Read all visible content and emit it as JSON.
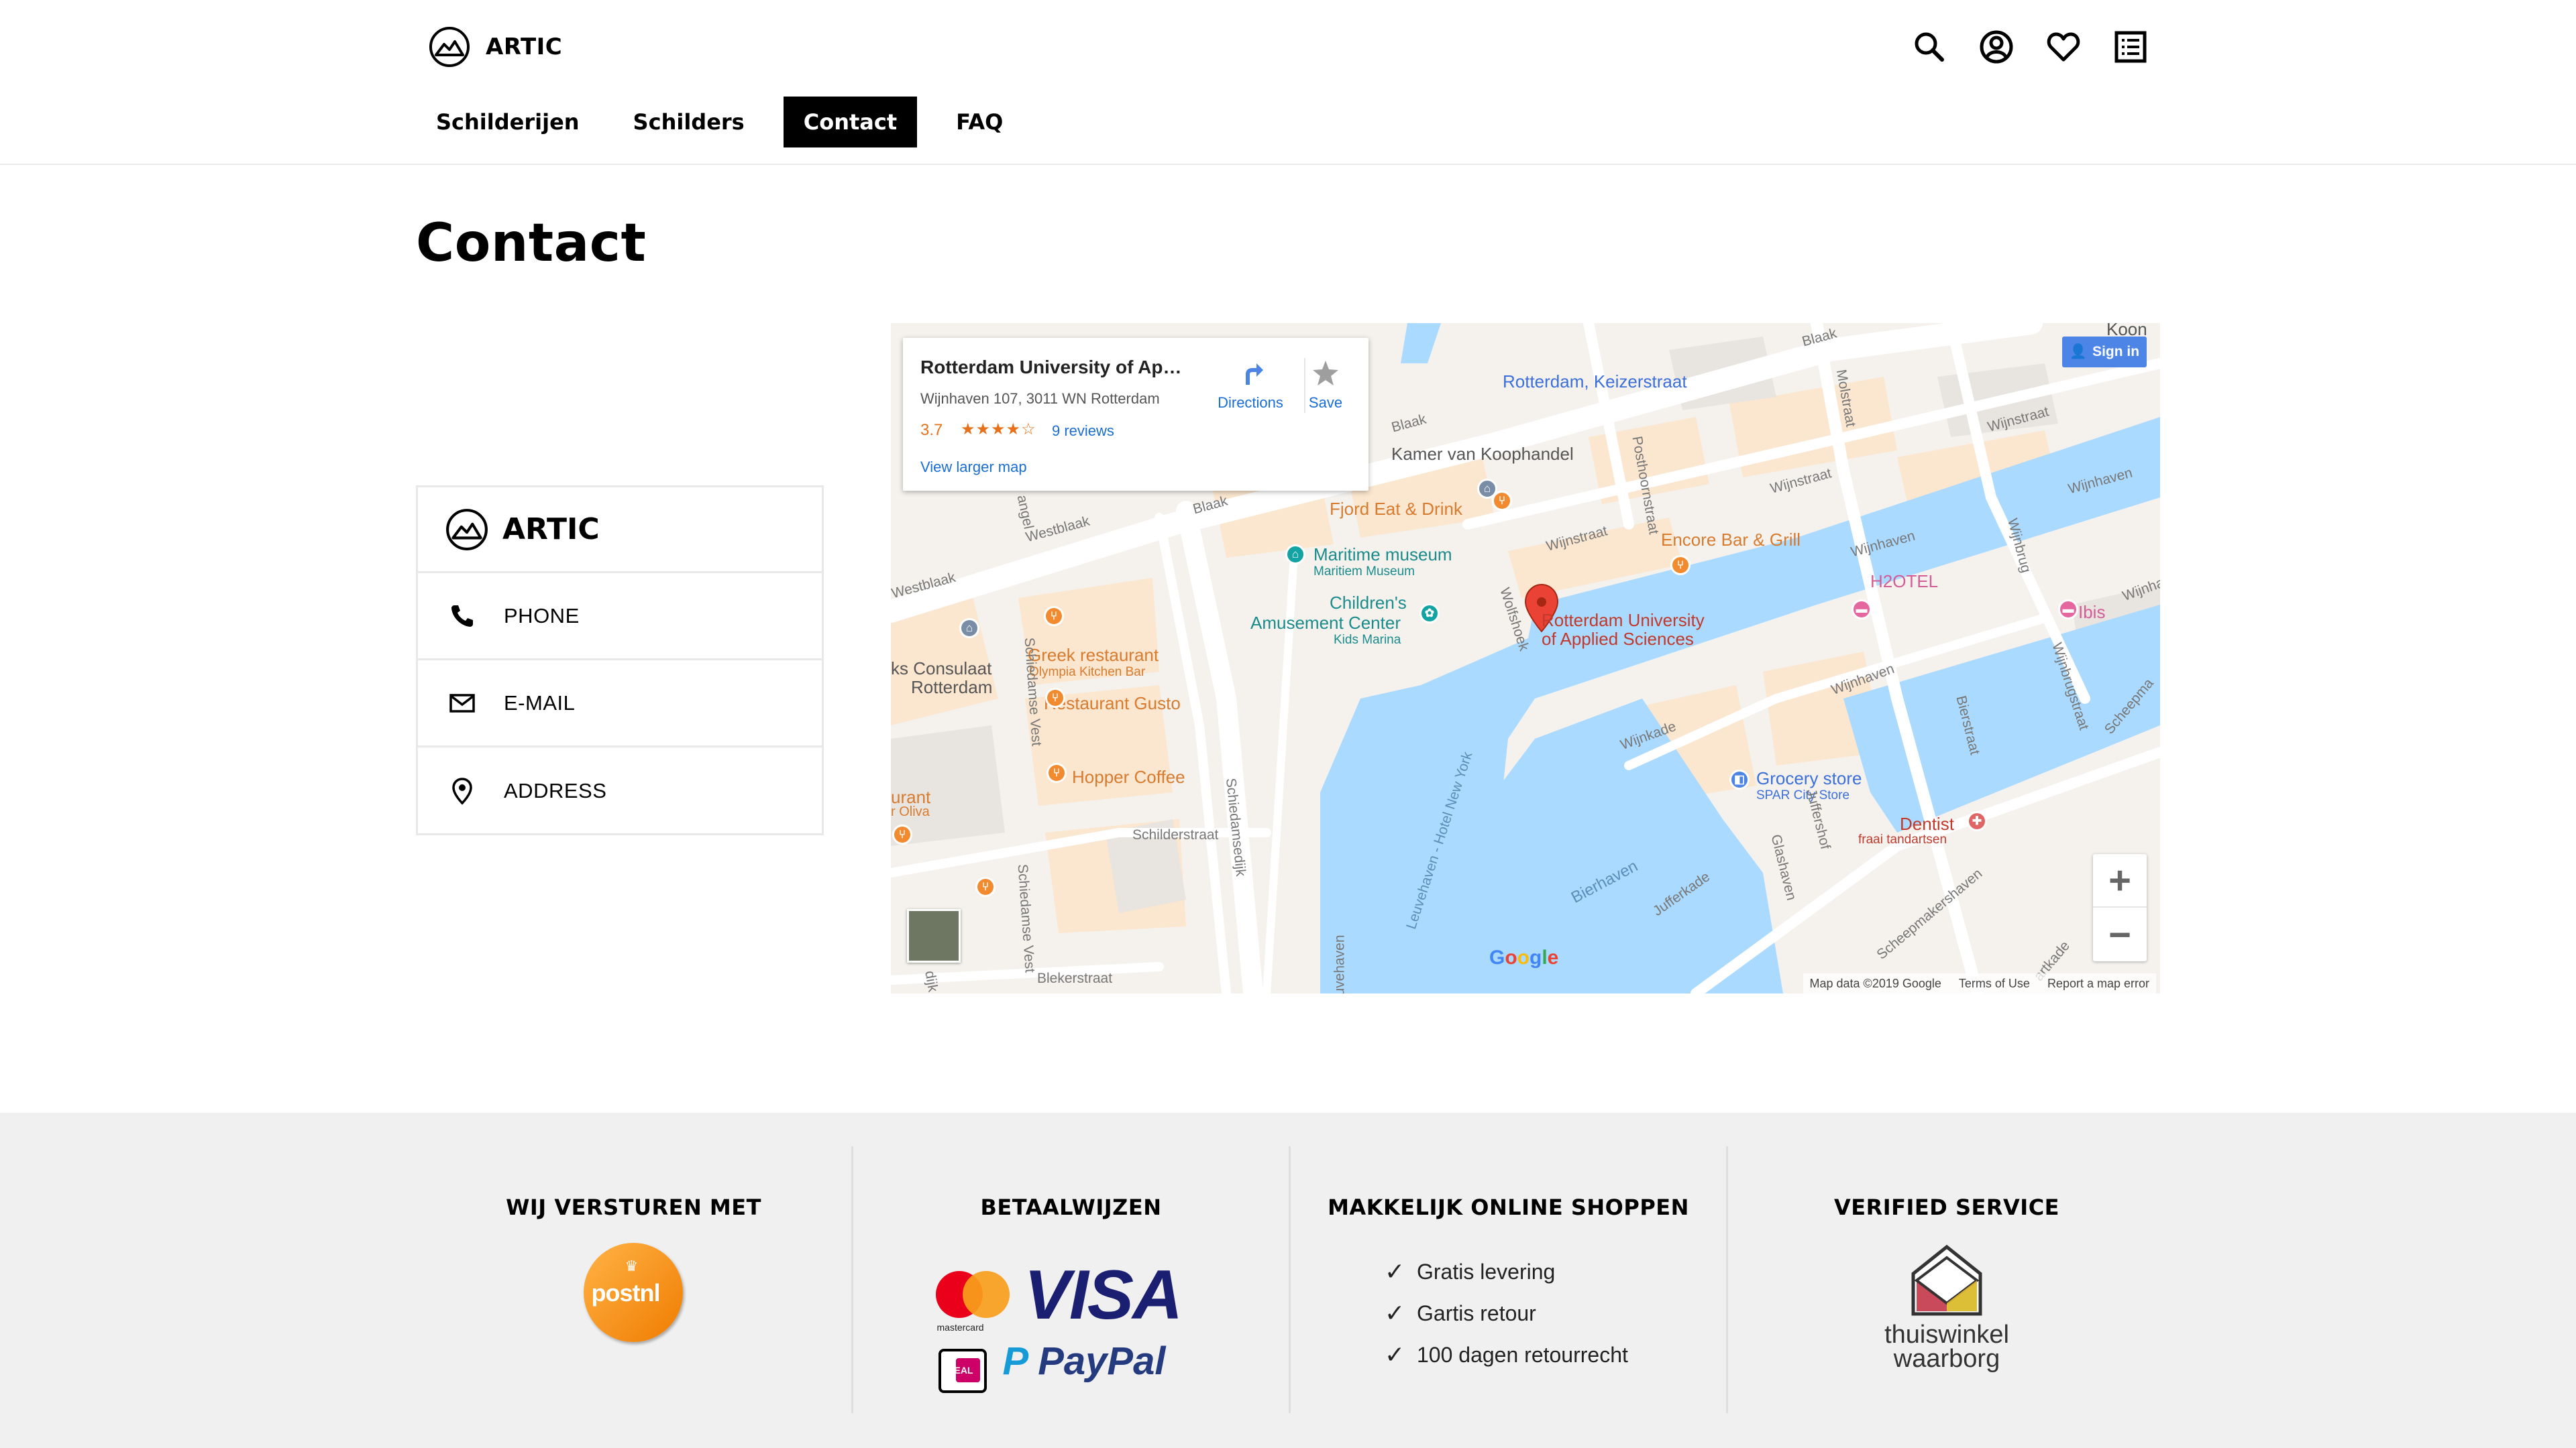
{
  "header": {
    "brand": "ARTIC",
    "nav": [
      {
        "label": "Schilderijen",
        "active": false
      },
      {
        "label": "Schilders",
        "active": false
      },
      {
        "label": "Contact",
        "active": true
      },
      {
        "label": "FAQ",
        "active": false
      }
    ],
    "icons": [
      "search-icon",
      "account-icon",
      "heart-icon",
      "list-icon"
    ]
  },
  "page": {
    "title": "Contact"
  },
  "contact_card": {
    "brand": "ARTIC",
    "rows": [
      {
        "icon": "phone-icon",
        "label": "PHONE"
      },
      {
        "icon": "mail-icon",
        "label": "E-MAIL"
      },
      {
        "icon": "location-pin-icon",
        "label": "ADDRESS"
      }
    ]
  },
  "map": {
    "info": {
      "title": "Rotterdam University of Applied Sciences",
      "title_display": "Rotterdam University of Appli...",
      "address": "Wijnhaven 107, 3011 WN Rotterdam",
      "rating": "3.7",
      "stars": "★★★★☆",
      "reviews": "9 reviews",
      "view_larger": "View larger map",
      "directions": "Directions",
      "save": "Save"
    },
    "sign_in": "Sign in",
    "zoom_in": "+",
    "zoom_out": "−",
    "google": "Google",
    "footer": [
      "Map data ©2019 Google",
      "Terms of Use",
      "Report a map error"
    ],
    "labels": {
      "keizerstraat": "Rotterdam, Keizerstraat",
      "kamer": "Kamer van Koophandel",
      "fjord": "Fjord Eat & Drink",
      "maritime": "Maritime museum",
      "maritime_sub": "Maritiem Museum",
      "childrens_1": "Children's",
      "childrens_2": "Amusement Center",
      "childrens_sub": "Kids Marina",
      "rotterdam_univ_1": "Rotterdam University",
      "rotterdam_univ_2": "of Applied Sciences",
      "encore": "Encore Bar & Grill",
      "h2otel": "H2OTEL",
      "ibis": "Ibis",
      "greek": "Greek restaurant",
      "greek_sub": "Olympia Kitchen Bar",
      "gusto": "Restaurant Gusto",
      "hopper": "Hopper Coffee",
      "consulaat_1": "ks Consulaat",
      "consulaat_2": "Rotterdam",
      "rant": "urant",
      "oliva": "r Oliva",
      "grocery": "Grocery store",
      "grocery_sub": "SPAR City Store",
      "dentist": "Dentist",
      "dentist_sub": "fraai tandartsen",
      "koon": "Koon",
      "streets": {
        "westblaak1": "Westblaak",
        "westblaak2": "Westblaak",
        "blaak1": "Blaak",
        "blaak2": "Blaak",
        "blaak3": "Blaak",
        "wijnstraat1": "Wijnstraat",
        "wijnstraat2": "Wijnstraat",
        "wijnstraat3": "Wijnstraat",
        "wijnhaven1": "Wijnhaven",
        "wijnhaven2": "Wijnhaven",
        "wijnhaven3": "Wijnhaven",
        "wijnhaven4": "Wijnhaven",
        "wijnkade": "Wijnkade",
        "bierhaven": "Bierhaven",
        "jufferkade": "Jufferkade",
        "schilderstraat": "Schilderstraat",
        "blekerstraat": "Blekerstraat",
        "schiedamsedijk": "Schiedamsedijk",
        "leuvehaven": "Leuvehaven - Hotel New York",
        "wolfshoek": "Wolfshoek",
        "posthoornstraat": "Posthoornstraat",
        "molstraat": "Molstraat",
        "wijnbrug": "Wijnbrug",
        "wijnbrugstraat": "Wijnbrugstraat",
        "bierstraat": "Bierstraat",
        "glashaven": "Glashaven",
        "scheepmakershaven": "Scheepmakershaven",
        "scheepma": "Scheepma",
        "juffershof": "Juffershof",
        "schiedamse_vest1": "Schiedamse Vest",
        "schiedamse_vest2": "Schiedamse Vest",
        "angel": "angel",
        "dijk": "dijk",
        "uvehaven": "uvehaven",
        "artkade": "artkade",
        "ibis2": "Ibis"
      }
    }
  },
  "footer": {
    "ship": {
      "title": "WIJ VERSTUREN MET",
      "logo_text": "postnl"
    },
    "pay": {
      "title": "BETAALWIJZEN",
      "mastercard": "mastercard",
      "visa": "VISA",
      "ideal": "iDEAL",
      "paypal": "PayPal"
    },
    "shop": {
      "title": "MAKKELIJK ONLINE SHOPPEN",
      "items": [
        "Gratis levering",
        "Gartis retour",
        "100 dagen retourrecht"
      ]
    },
    "verified": {
      "title": "VERIFIED SERVICE",
      "logo_line1": "thuiswinkel",
      "logo_line2": "waarborg"
    }
  },
  "colors": {
    "accent": "#000000",
    "water": "#aadaff",
    "map_pin": "#ea4335",
    "link_blue": "#1a6dd4",
    "rating_orange": "#e7711b",
    "footer_bg": "#f0f0f0"
  }
}
